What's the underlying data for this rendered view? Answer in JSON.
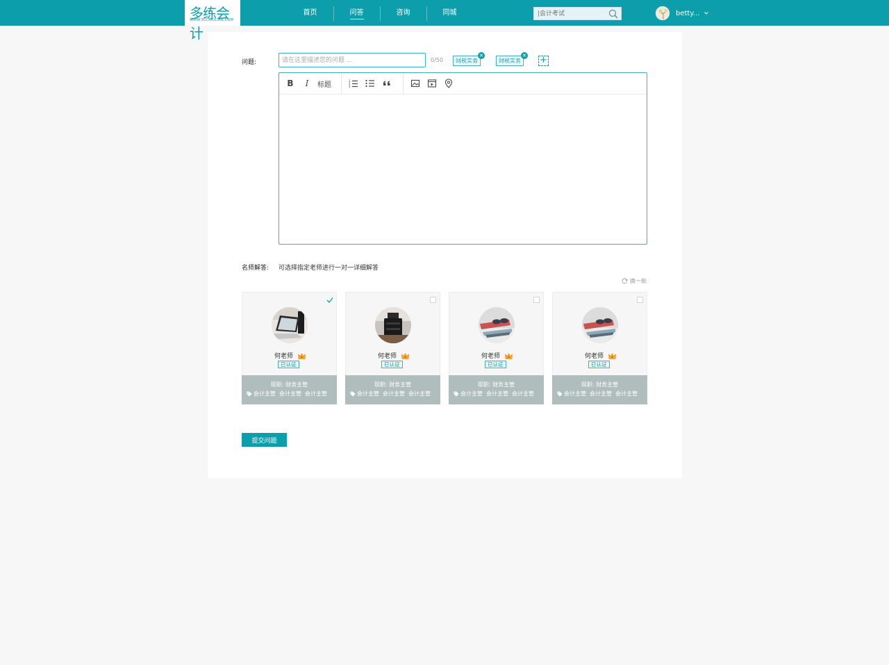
{
  "header": {
    "logo_text": "多练会计",
    "logo_subtext": "WWW.91DUOLIAN.COM",
    "nav": [
      {
        "label": "首页",
        "active": false
      },
      {
        "label": "问答",
        "active": true
      },
      {
        "label": "咨询",
        "active": false
      },
      {
        "label": "同城",
        "active": false
      }
    ],
    "search_placeholder": "|会计考试",
    "user_name": "betty..."
  },
  "question": {
    "label": "问题:",
    "input_placeholder": "请在这里描述您的问题 ...",
    "counter": "0/50",
    "tags": [
      "财税实务",
      "财税实务"
    ],
    "tag_remove": "×",
    "tag_add": "+"
  },
  "editor": {
    "bold": "B",
    "italic": "I",
    "heading": "标题"
  },
  "teachers": {
    "label": "名师解答:",
    "tip": "可选择指定老师进行一对一详细解答",
    "refresh": "换一批",
    "cards": [
      {
        "name": "何老师",
        "badge": "已认证",
        "job": "现职:  财务主管",
        "tags": [
          "会计主管",
          "会计主管",
          "会计主管"
        ],
        "selected": true,
        "avatar": "laptop-photo"
      },
      {
        "name": "何老师",
        "badge": "已认证",
        "job": "现职:  财务主管",
        "tags": [
          "会计主管",
          "会计主管",
          "会计主管"
        ],
        "selected": false,
        "avatar": "camera-lens-photo"
      },
      {
        "name": "何老师",
        "badge": "已认证",
        "job": "现职:  财务主管",
        "tags": [
          "会计主管",
          "会计主管",
          "会计主管"
        ],
        "selected": false,
        "avatar": "sunglasses-photo"
      },
      {
        "name": "何老师",
        "badge": "已认证",
        "job": "现职:  财务主管",
        "tags": [
          "会计主管",
          "会计主管",
          "会计主管"
        ],
        "selected": false,
        "avatar": "sunglasses-photo"
      }
    ]
  },
  "submit_label": "提交问题",
  "colors": {
    "brand": "#0c9eab",
    "card_footer": "#b0bdbd",
    "page_bg": "#f7f7f7"
  }
}
